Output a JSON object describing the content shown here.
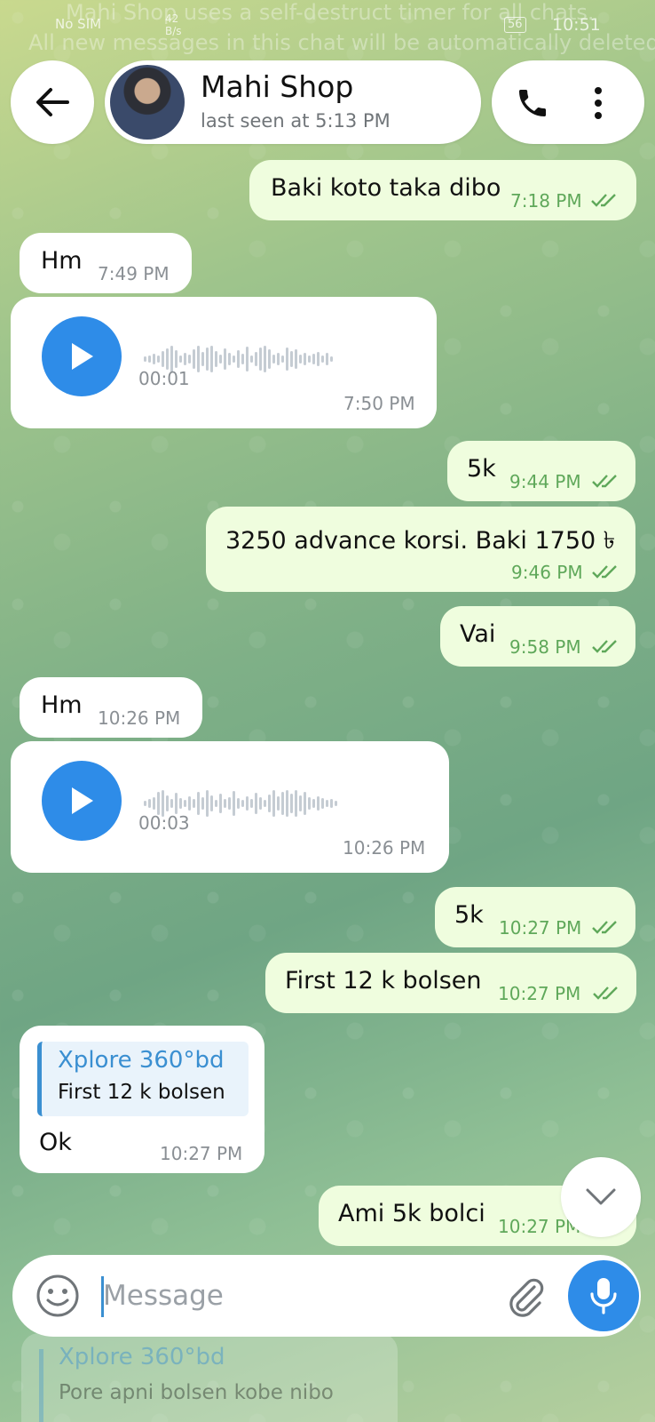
{
  "status_bar": {
    "sim": "No SIM",
    "net_speed": "42\nB/s",
    "battery": "56",
    "time": "10:51"
  },
  "system_overlay": {
    "line1": "Mahi Shop uses a self-destruct timer for all chats.",
    "line2": "All new messages in this chat will be automatically deleted"
  },
  "header": {
    "contact_name": "Mahi Shop",
    "last_seen": "last seen at 5:13 PM"
  },
  "messages": [
    {
      "dir": "out",
      "type": "text",
      "text": "Baki koto taka dibo",
      "time": "7:18 PM",
      "read": true
    },
    {
      "dir": "in",
      "type": "text",
      "text": "Hm",
      "time": "7:49 PM"
    },
    {
      "dir": "in",
      "type": "voice",
      "duration": "00:01",
      "time": "7:50 PM"
    },
    {
      "dir": "out",
      "type": "text",
      "text": "5k",
      "time": "9:44 PM",
      "read": true
    },
    {
      "dir": "out",
      "type": "text",
      "text": "3250 advance korsi. Baki 1750 ৳",
      "time": "9:46 PM",
      "read": true
    },
    {
      "dir": "out",
      "type": "text",
      "text": "Vai",
      "time": "9:58 PM",
      "read": true
    },
    {
      "dir": "in",
      "type": "text",
      "text": "Hm",
      "time": "10:26 PM"
    },
    {
      "dir": "in",
      "type": "voice",
      "duration": "00:03",
      "time": "10:26 PM"
    },
    {
      "dir": "out",
      "type": "text",
      "text": "5k",
      "time": "10:27 PM",
      "read": true
    },
    {
      "dir": "out",
      "type": "text",
      "text": "First 12 k bolsen",
      "time": "10:27 PM",
      "read": true
    },
    {
      "dir": "in",
      "type": "reply",
      "reply_to_name": "Xplore 360°bd",
      "reply_to_text": "First 12 k bolsen",
      "text": "Ok",
      "time": "10:27 PM"
    },
    {
      "dir": "out",
      "type": "text",
      "text": "Ami 5k bolci",
      "time": "10:27 PM",
      "read": true
    }
  ],
  "composer": {
    "placeholder": "Message",
    "value": ""
  },
  "ghost_preview": {
    "name": "Xplore 360°bd",
    "text": "Pore apni bolsen kobe nibo"
  },
  "colors": {
    "accent": "#2e8ce8",
    "outgoing_bubble": "#effdde",
    "read_ticks": "#5fa85a"
  },
  "icons": [
    "back-arrow-icon",
    "phone-icon",
    "more-vertical-icon",
    "play-icon",
    "chevron-down-icon",
    "emoji-icon",
    "attach-icon",
    "mic-icon",
    "double-check-icon"
  ]
}
